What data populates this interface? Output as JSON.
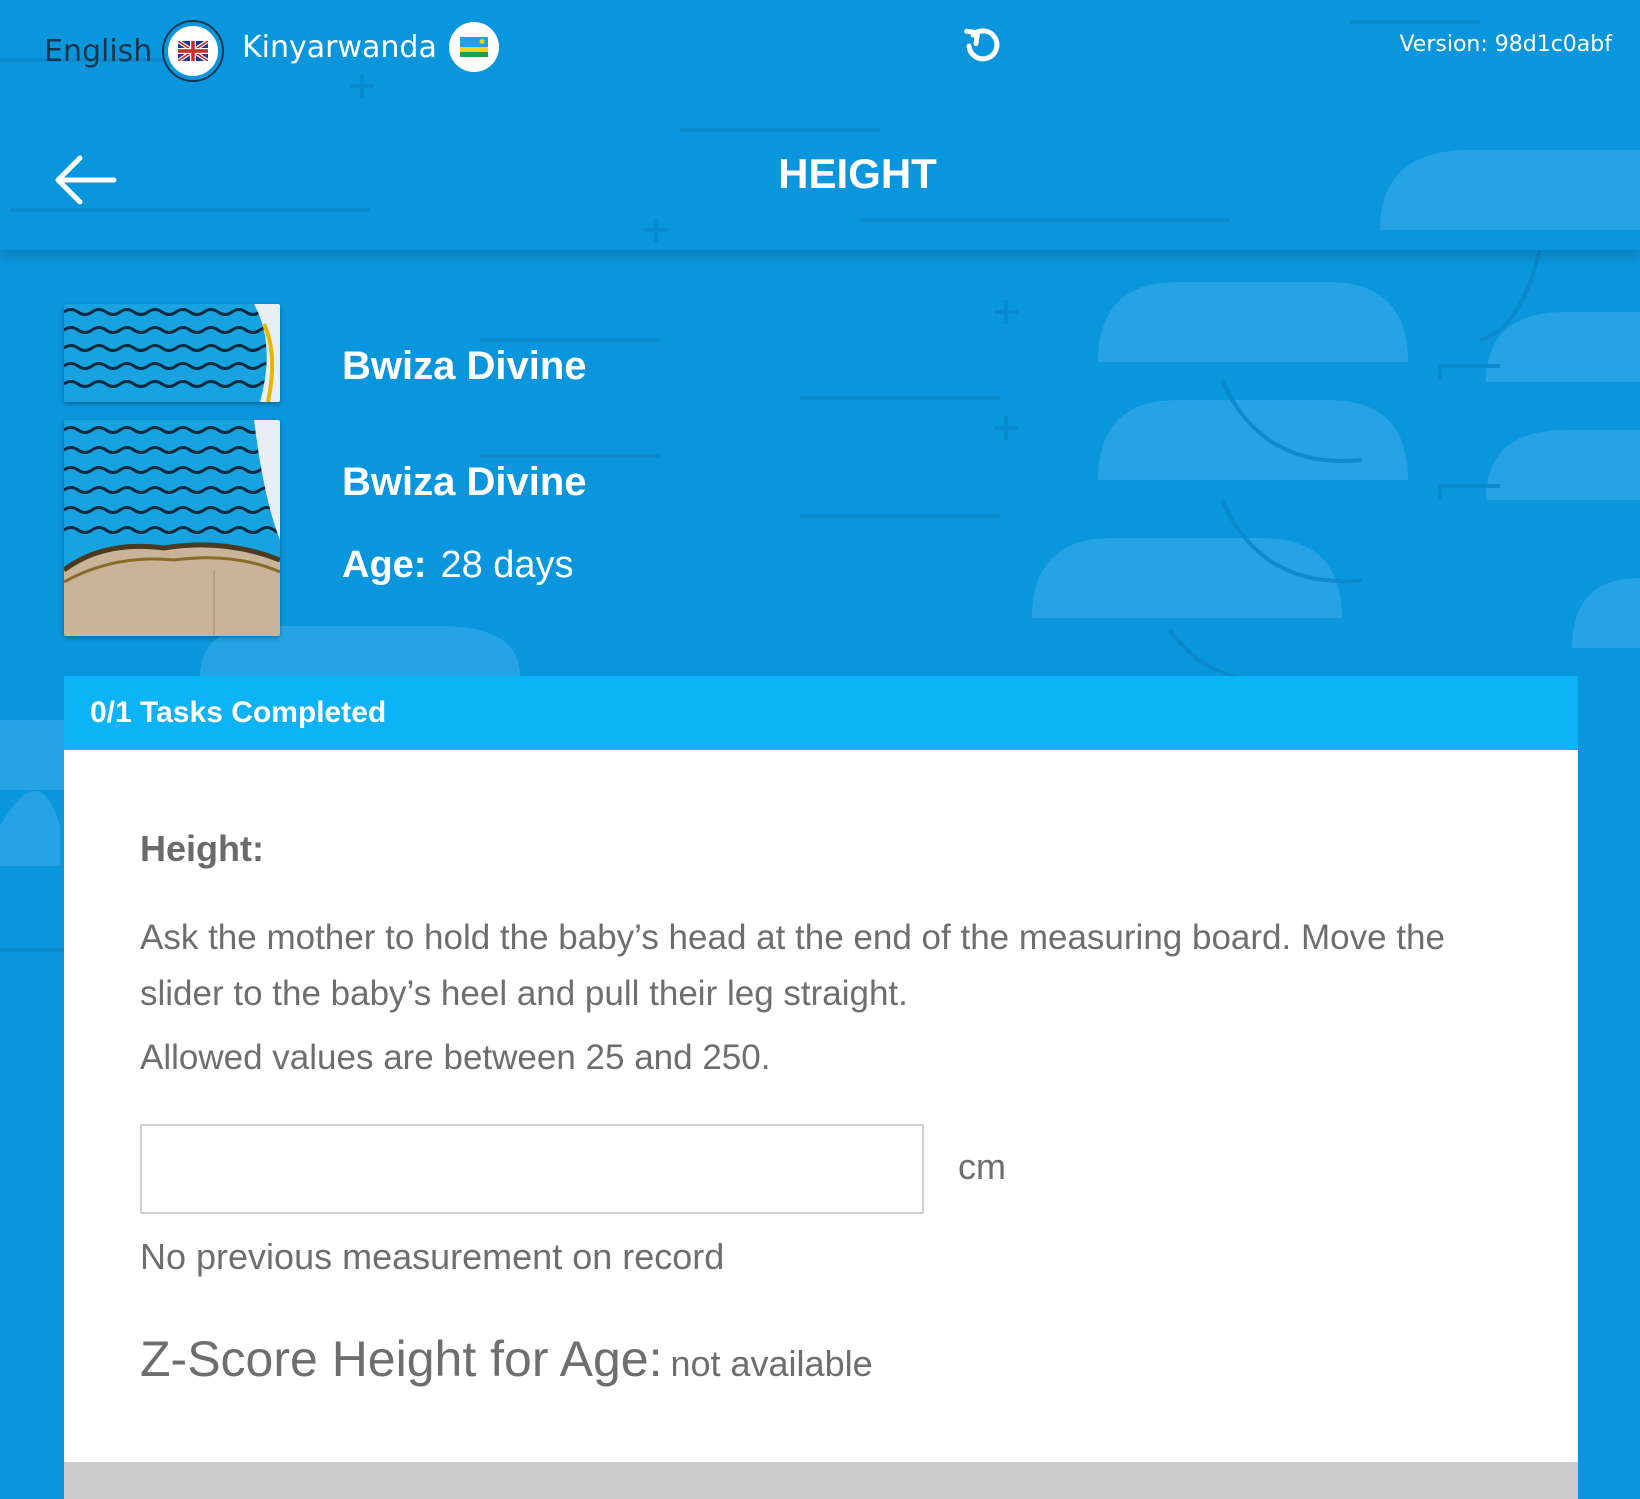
{
  "topbar": {
    "languages": [
      {
        "label": "English",
        "flag": "uk-flag-icon",
        "active": true
      },
      {
        "label": "Kinyarwanda",
        "flag": "rwanda-flag-icon",
        "active": false
      }
    ],
    "refresh_icon": "refresh-icon",
    "version": "Version: 98d1c0abf"
  },
  "header": {
    "back_icon": "arrow-left-icon",
    "title": "HEIGHT"
  },
  "patients": [
    {
      "name": "Bwiza Divine"
    },
    {
      "name": "Bwiza Divine",
      "age_label": "Age:",
      "age_value": "28 days"
    }
  ],
  "card": {
    "progress": "0/1 Tasks Completed",
    "question_label": "Height:",
    "instructions": "Ask the mother to hold the baby’s head at the end of the measuring board. Move the slider to the baby’s heel and pull their leg straight.",
    "allowed": "Allowed values are between 25 and 250.",
    "input_value": "",
    "unit": "cm",
    "previous": "No previous measurement on record",
    "zscore_label": "Z-Score Height for Age:",
    "zscore_value": "not available"
  },
  "colors": {
    "background": "#0a96dd",
    "card_header": "#0db3f7",
    "text_grey": "#6e6e6e"
  }
}
